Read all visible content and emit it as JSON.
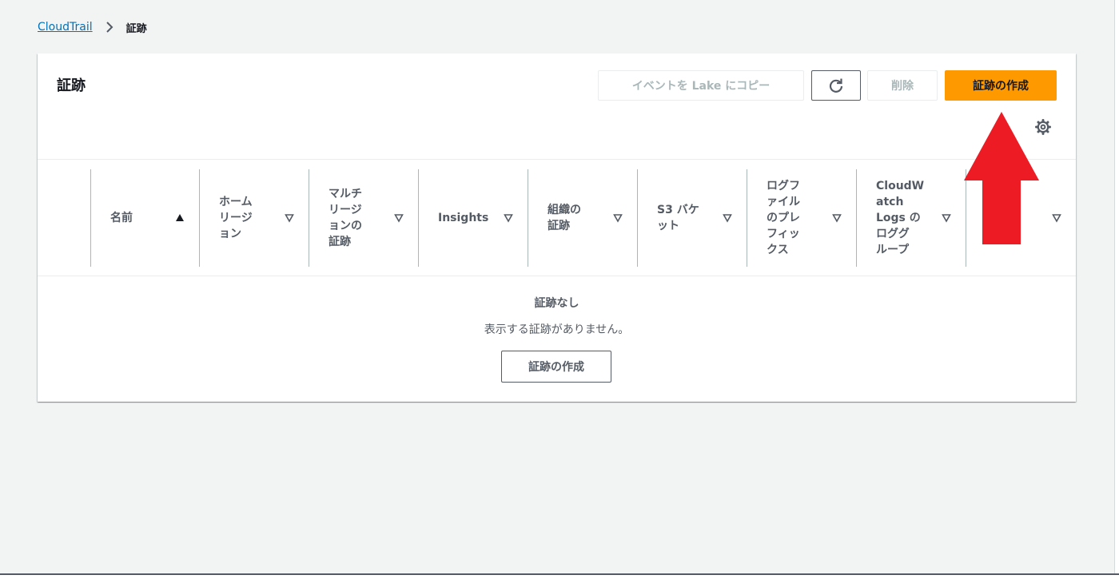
{
  "breadcrumb": {
    "root": "CloudTrail",
    "current": "証跡"
  },
  "panel": {
    "title": "証跡",
    "buttons": {
      "copy_to_lake": "イベントを Lake にコピー",
      "delete": "削除",
      "create": "証跡の作成"
    }
  },
  "table": {
    "columns": [
      {
        "label": "名前",
        "sort": "ascending"
      },
      {
        "label": "ホーム\nリージ\nョン",
        "sort": "none"
      },
      {
        "label": "マルチ\nリージ\nョンの\n証跡",
        "sort": "none"
      },
      {
        "label": "Insights",
        "sort": "none"
      },
      {
        "label": "組織の\n証跡",
        "sort": "none"
      },
      {
        "label": "S3 バケ\nット",
        "sort": "none"
      },
      {
        "label": "ログフ\nァイル\nのプレ\nフィッ\nクス",
        "sort": "none"
      },
      {
        "label": "CloudW\natch\nLogs の\nロググ\nループ",
        "sort": "none"
      },
      {
        "label": "",
        "sort": "none"
      }
    ],
    "empty": {
      "title": "証跡なし",
      "description": "表示する証跡がありません。",
      "create_button": "証跡の作成"
    }
  },
  "colors": {
    "primary_button": "#ff9900",
    "link": "#0073bb",
    "annotation_arrow": "#ed1c24"
  },
  "icons": {
    "breadcrumb_separator": "chevron-right-icon",
    "refresh": "refresh-icon",
    "settings": "gear-icon",
    "sort_ascending": "sort-ascending-icon",
    "sort_none": "sort-descending-outline-icon",
    "annotation": "red-up-arrow"
  }
}
